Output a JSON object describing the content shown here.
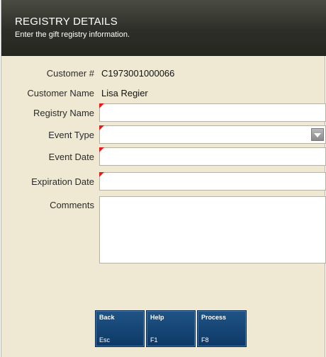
{
  "header": {
    "title": "REGISTRY DETAILS",
    "subtitle": "Enter the gift registry information."
  },
  "customer": {
    "number_label": "Customer #",
    "number_value": "C1973001000066",
    "name_label": "Customer Name",
    "name_value": "Lisa Regier"
  },
  "form": {
    "registry_name": {
      "label": "Registry Name",
      "value": "",
      "required": true
    },
    "event_type": {
      "label": "Event Type",
      "value": "",
      "required": true
    },
    "event_date": {
      "label": "Event Date",
      "value": "",
      "required": true
    },
    "expiration_date": {
      "label": "Expiration Date",
      "value": "",
      "required": true
    },
    "comments": {
      "label": "Comments",
      "value": ""
    }
  },
  "function_keys": [
    {
      "label": "Back",
      "key": "Esc"
    },
    {
      "label": "Help",
      "key": "F1"
    },
    {
      "label": "Process",
      "key": "F8"
    }
  ],
  "colors": {
    "header_bg": "#2d2e28",
    "panel_bg": "#efe9d3",
    "required_marker": "#e31c1c",
    "button_bg": "#0d3866"
  },
  "icons": {
    "dropdown": "chevron-down-icon",
    "required": "required-marker-icon"
  }
}
